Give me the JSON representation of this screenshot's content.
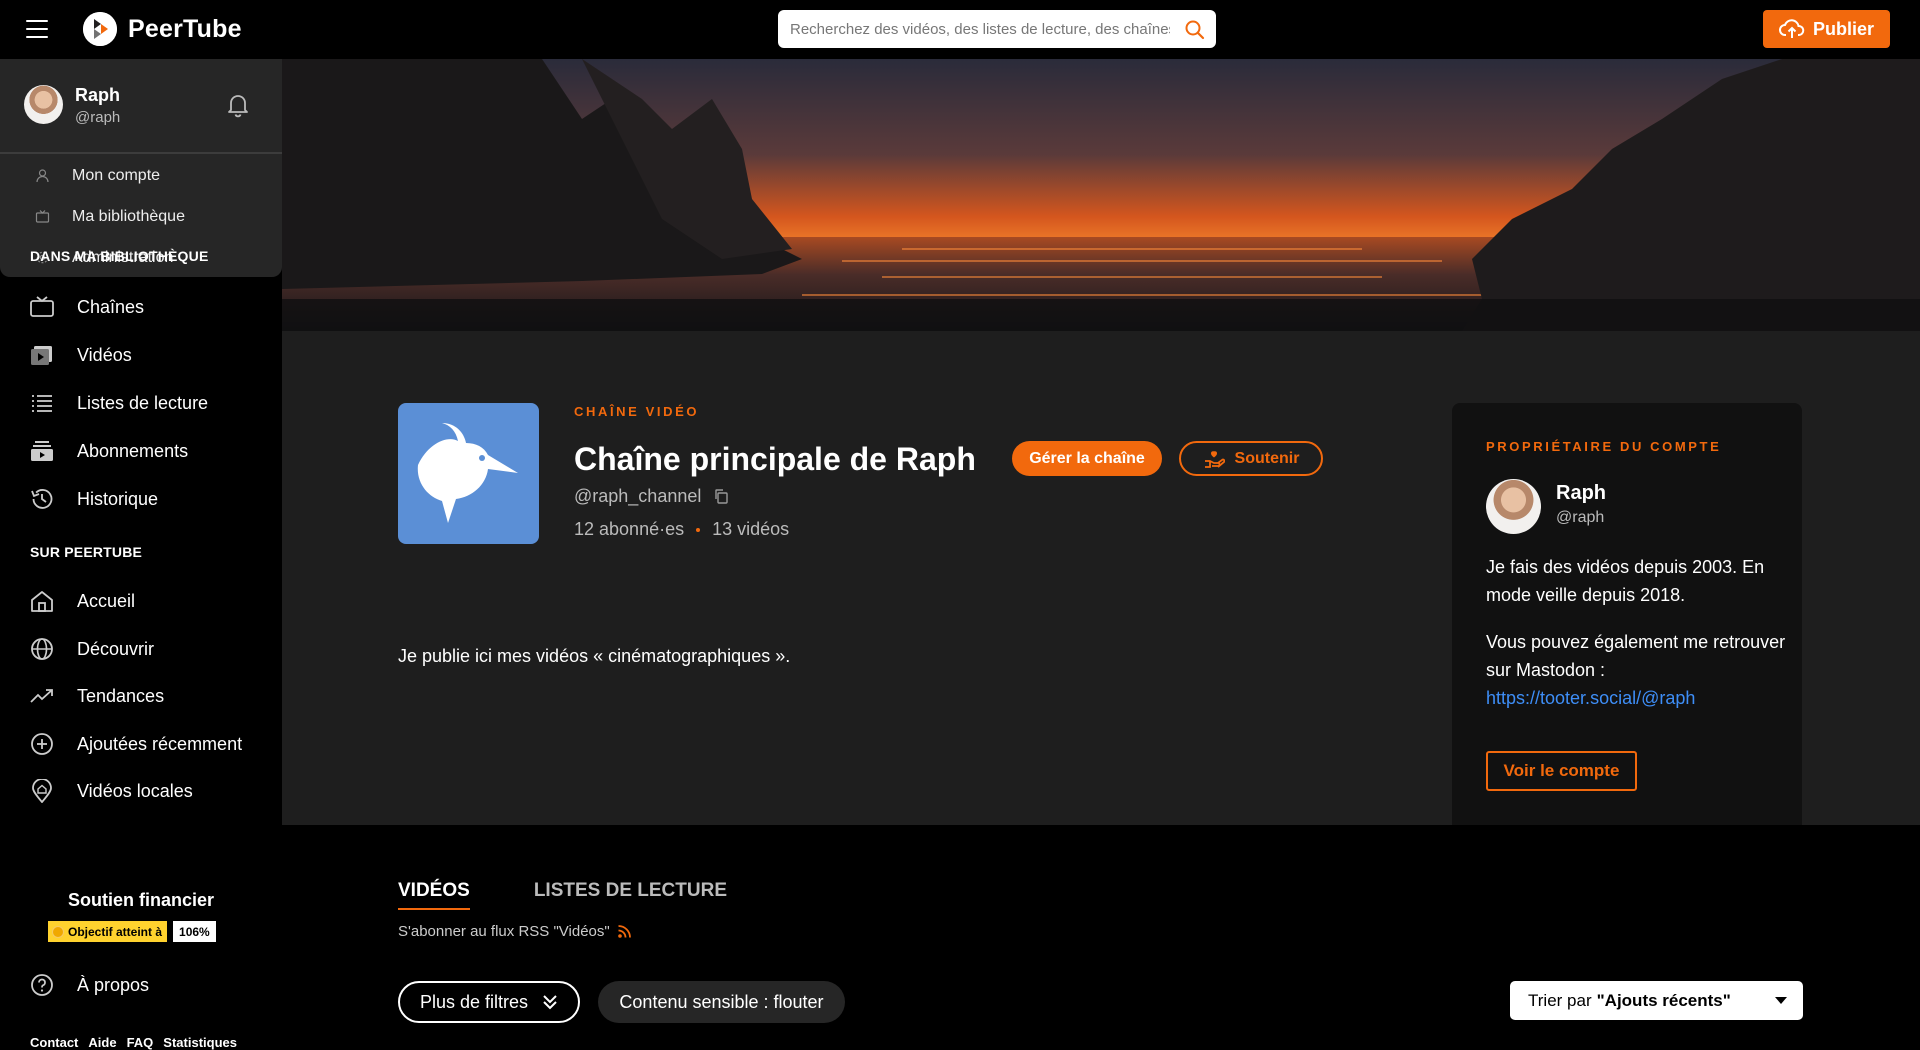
{
  "header": {
    "app_name": "PeerTube",
    "search_placeholder": "Recherchez des vidéos, des listes de lecture, des chaînes…",
    "publish_label": "Publier"
  },
  "user": {
    "name": "Raph",
    "handle": "@raph",
    "menu": [
      {
        "label": "Mon compte",
        "icon": "user-icon"
      },
      {
        "label": "Ma bibliothèque",
        "icon": "library-icon"
      },
      {
        "label": "Administration",
        "icon": "cog-icon"
      }
    ]
  },
  "sidebar": {
    "library_title": "DANS MA BIBLIOTHÈQUE",
    "library_items": [
      {
        "label": "Chaînes",
        "icon": "channels-icon"
      },
      {
        "label": "Vidéos",
        "icon": "videos-icon"
      },
      {
        "label": "Listes de lecture",
        "icon": "playlists-icon"
      },
      {
        "label": "Abonnements",
        "icon": "subscriptions-icon"
      },
      {
        "label": "Historique",
        "icon": "history-icon"
      }
    ],
    "peertube_title": "SUR PEERTUBE",
    "peertube_items": [
      {
        "label": "Accueil",
        "icon": "home-icon"
      },
      {
        "label": "Découvrir",
        "icon": "globe-icon"
      },
      {
        "label": "Tendances",
        "icon": "trending-icon"
      },
      {
        "label": "Ajoutées récemment",
        "icon": "plus-circle-icon"
      },
      {
        "label": "Vidéos locales",
        "icon": "home-pin-icon"
      }
    ],
    "funding": {
      "title": "Soutien financier",
      "badge_label": "Objectif atteint à",
      "badge_value": "106%"
    },
    "about_label": "À propos",
    "footer_links": [
      "Contact",
      "Aide",
      "FAQ",
      "Statistiques"
    ]
  },
  "channel": {
    "kicker": "CHAÎNE VIDÉO",
    "title": "Chaîne principale de Raph",
    "manage_label": "Gérer la chaîne",
    "support_label": "Soutenir",
    "handle": "@raph_channel",
    "subscribers": "12 abonné·es",
    "videos": "13 vidéos",
    "description": "Je publie ici mes vidéos « cinématographiques »."
  },
  "owner": {
    "kicker": "PROPRIÉTAIRE DU COMPTE",
    "name": "Raph",
    "handle": "@raph",
    "bio_line1": "Je fais des vidéos depuis 2003. En mode veille depuis 2018.",
    "bio_line2": "Vous pouvez également me retrouver sur Mastodon :",
    "link": "https://tooter.social/@raph",
    "view_account_label": "Voir le compte"
  },
  "tabs": [
    {
      "label": "VIDÉOS",
      "active": true
    },
    {
      "label": "LISTES DE LECTURE",
      "active": false
    }
  ],
  "rss_label": "S'abonner au flux RSS \"Vidéos\"",
  "filters": {
    "more_filters_label": "Plus de filtres",
    "sensitive_label": "Contenu sensible : flouter",
    "sort_prefix": "Trier par",
    "sort_value": "\"Ajouts récents\""
  },
  "colors": {
    "accent": "#f2690d",
    "link": "#3e8ef7",
    "channel_avatar_bg": "#5b8fd6"
  }
}
